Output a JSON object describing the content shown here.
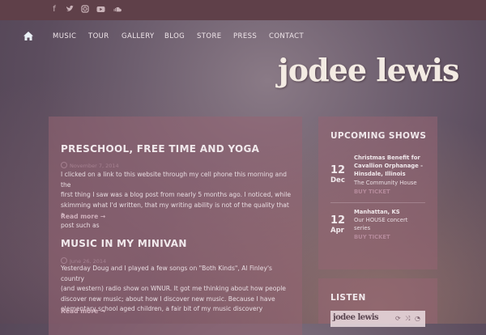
{
  "social_icons": [
    "facebook-icon",
    "twitter-icon",
    "instagram-icon",
    "youtube-icon",
    "soundcloud-icon"
  ],
  "nav": {
    "home_icon": "home-icon",
    "items": [
      "MUSIC",
      "TOUR",
      "GALLERY",
      "BLOG",
      "STORE",
      "PRESS",
      "CONTACT"
    ]
  },
  "site": {
    "logo": "jodee lewis"
  },
  "posts": [
    {
      "title": "PRESCHOOL, FREE TIME AND YOGA",
      "date": "November 7, 2014",
      "lines": [
        "I clicked on a link to this website through my cell phone this morning and the",
        "first thing I saw was a blog post from nearly 5 months ago.  I noticed, while",
        "skimming what I'd written, that my writing ability is not of the quality that a",
        "post such as"
      ],
      "read_more": "Read more →"
    },
    {
      "title": "MUSIC IN MY MINIVAN",
      "date": "June 26, 2014",
      "lines": [
        "Yesterday Doug and I played a few songs on \"Both Kinds\", Al Finley's country",
        "(and western) radio show on WNUR.  It got me thinking about how people",
        "discover new music; about how I discover new music.  Because I have",
        "elementary school aged children, a fair bit of my music discovery"
      ],
      "read_more": "Read more →"
    }
  ],
  "upcoming": {
    "title": "UPCOMING SHOWS",
    "shows": [
      {
        "day": "12",
        "month": "Dec",
        "name_lines": [
          "Christmas Benefit for",
          "Cavallion Orphanage -",
          "Hinsdale, Illinois"
        ],
        "venue_lines": [
          "The Community House"
        ],
        "buy": "BUY TICKET"
      },
      {
        "day": "12",
        "month": "Apr",
        "name_lines": [
          "Manhattan, KS"
        ],
        "venue_lines": [
          "Our HOUSE concert",
          "series"
        ],
        "buy": "BUY TICKET"
      }
    ]
  },
  "listen": {
    "title": "LISTEN",
    "player_logo": "jodee lewis",
    "controls": [
      "repeat-icon",
      "shuffle-icon",
      "volume-icon"
    ]
  }
}
